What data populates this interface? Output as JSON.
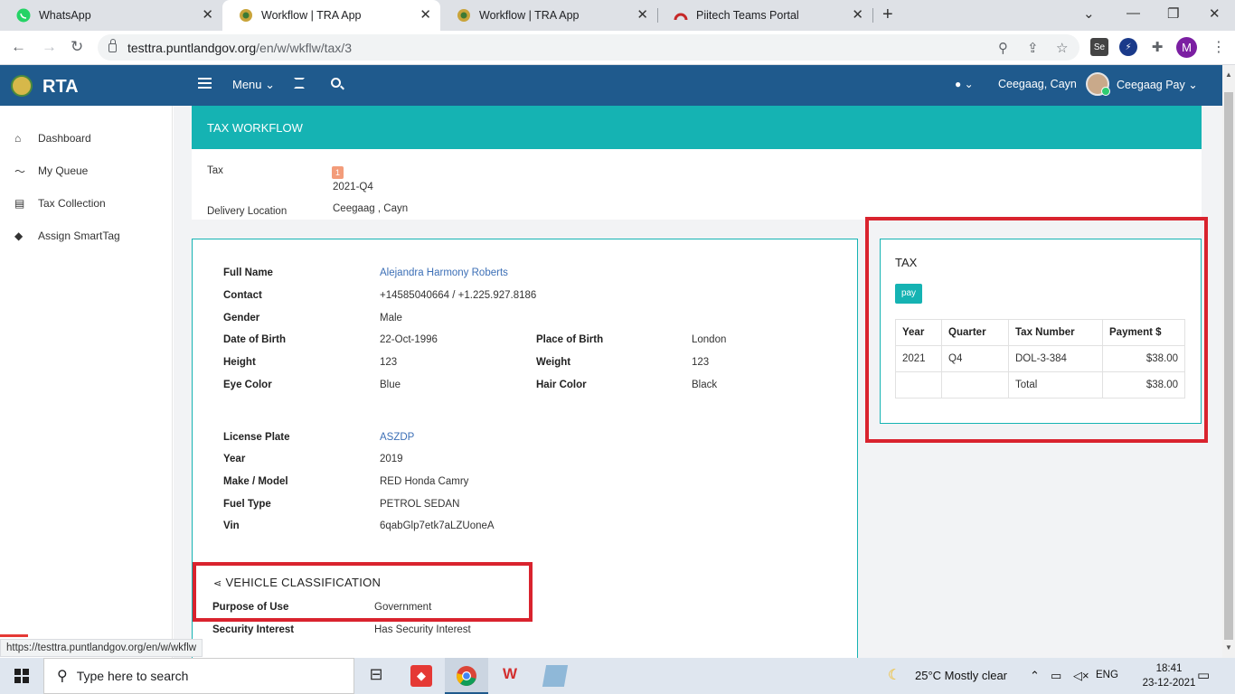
{
  "browser": {
    "tabs": [
      {
        "title": "WhatsApp"
      },
      {
        "title": "Workflow | TRA App"
      },
      {
        "title": "Workflow | TRA App"
      },
      {
        "title": "Piitech Teams Portal"
      }
    ],
    "url_host": "testtra.puntlandgov.org",
    "url_path": "/en/w/wkflw/tax/3",
    "status_url": "https://testtra.puntlandgov.org/en/w/wkflw",
    "profile_initial": "M"
  },
  "header": {
    "brand": "RTA",
    "menu_label": "Menu",
    "user_name": "Ceegaag, Cayn",
    "profile_name": "Ceegaag Pay"
  },
  "sidebar": {
    "items": [
      {
        "label": "Dashboard",
        "icon": "home-icon"
      },
      {
        "label": "My Queue",
        "icon": "trend-icon"
      },
      {
        "label": "Tax Collection",
        "icon": "card-icon"
      },
      {
        "label": "Assign SmartTag",
        "icon": "tag-icon"
      }
    ]
  },
  "workflow": {
    "title": "TAX WORKFLOW",
    "tax_label": "Tax",
    "tax_badge": "1",
    "tax_period": "2021-Q4",
    "delivery_label": "Delivery Location",
    "delivery_value": "Ceegaag , Cayn"
  },
  "person": {
    "full_name_label": "Full Name",
    "full_name": "Alejandra Harmony Roberts",
    "contact_label": "Contact",
    "contact": "+14585040664 / +1.225.927.8186",
    "gender_label": "Gender",
    "gender": "Male",
    "dob_label": "Date of Birth",
    "dob": "22-Oct-1996",
    "pob_label": "Place of Birth",
    "pob": "London",
    "height_label": "Height",
    "height": "123",
    "weight_label": "Weight",
    "weight": "123",
    "eye_label": "Eye Color",
    "eye": "Blue",
    "hair_label": "Hair Color",
    "hair": "Black"
  },
  "vehicle": {
    "plate_label": "License Plate",
    "plate": "ASZDP",
    "year_label": "Year",
    "year": "2019",
    "make_label": "Make / Model",
    "make": "RED Honda Camry",
    "fuel_label": "Fuel Type",
    "fuel": "PETROL SEDAN",
    "vin_label": "Vin",
    "vin": "6qabGlp7etk7aLZUoneA"
  },
  "classification": {
    "title": "VEHICLE CLASSIFICATION",
    "purpose_label": "Purpose of Use",
    "purpose": "Government",
    "security_label": "Security Interest",
    "security": "Has Security Interest"
  },
  "tax": {
    "title": "TAX",
    "pay_label": "pay",
    "columns": [
      "Year",
      "Quarter",
      "Tax Number",
      "Payment $"
    ],
    "rows": [
      {
        "year": "2021",
        "quarter": "Q4",
        "number": "DOL-3-384",
        "payment": "$38.00"
      }
    ],
    "total_label": "Total",
    "total": "$38.00"
  },
  "taskbar": {
    "search_placeholder": "Type here to search",
    "weather": "25°C  Mostly clear",
    "lang": "ENG",
    "time": "18:41",
    "date": "23-12-2021"
  },
  "colors": {
    "header": "#1f5a8d",
    "accent": "#15b3b3",
    "highlight": "#d9232e"
  }
}
